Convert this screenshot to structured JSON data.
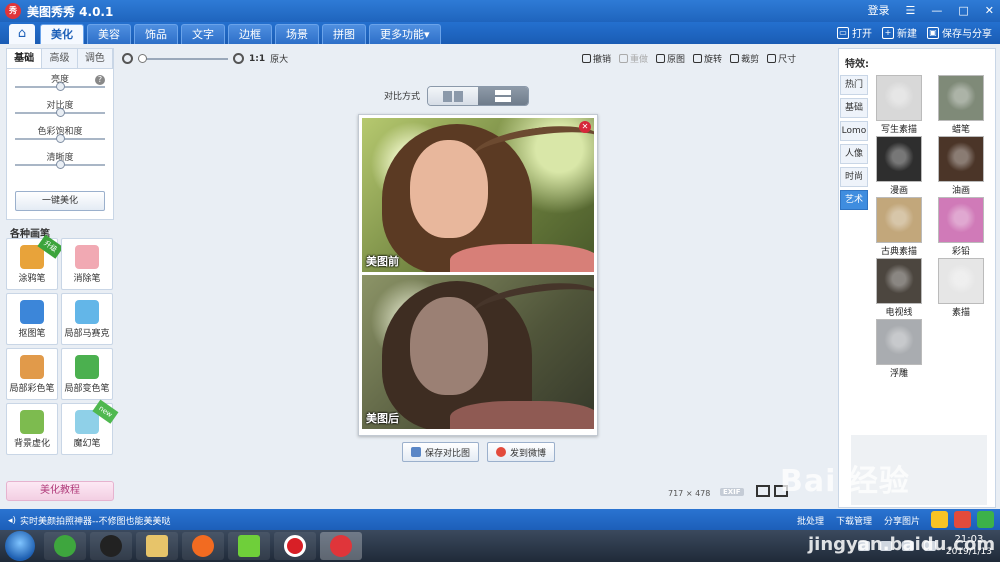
{
  "app": {
    "title": "美图秀秀 4.0.1",
    "logo_text": "秀"
  },
  "titlebar": {
    "login": "登录",
    "menu": "☰",
    "minimize": "—",
    "maximize": "□",
    "close": "✕"
  },
  "tabs": [
    {
      "label": "美化",
      "active": true
    },
    {
      "label": "美容",
      "active": false
    },
    {
      "label": "饰品",
      "active": false
    },
    {
      "label": "文字",
      "active": false
    },
    {
      "label": "边框",
      "active": false
    },
    {
      "label": "场景",
      "active": false
    },
    {
      "label": "拼图",
      "active": false
    },
    {
      "label": "更多功能▾",
      "active": false
    }
  ],
  "file_actions": {
    "open": "打开",
    "new": "新建",
    "save_share": "保存与分享"
  },
  "left_panel": {
    "sub_tabs": [
      "基础",
      "高级",
      "调色"
    ],
    "sliders": [
      {
        "label": "亮度",
        "value": 0.5
      },
      {
        "label": "对比度",
        "value": 0.5
      },
      {
        "label": "色彩饱和度",
        "value": 0.5
      },
      {
        "label": "清晰度",
        "value": 0.5
      }
    ],
    "one_click": "一键美化",
    "brush_title": "各种画笔",
    "brushes": [
      {
        "label": "涂鸦笔",
        "badge": "升级",
        "color": "#e8a33a"
      },
      {
        "label": "消除笔",
        "badge": "",
        "color": "#f1a9b3"
      },
      {
        "label": "抠图笔",
        "badge": "",
        "color": "#3c86d9"
      },
      {
        "label": "局部马赛克",
        "badge": "",
        "color": "#63b6e8"
      },
      {
        "label": "局部彩色笔",
        "badge": "",
        "color": "#e19a4a"
      },
      {
        "label": "局部变色笔",
        "badge": "",
        "color": "#4bb04f"
      },
      {
        "label": "背景虚化",
        "badge": "",
        "color": "#7dbb4f"
      },
      {
        "label": "魔幻笔",
        "badge": "new",
        "color": "#8fd0e8"
      }
    ],
    "tutorial": "美化教程"
  },
  "toolbar": {
    "zoom_ratio": "1:1",
    "zoom_label": "原大",
    "tools": [
      {
        "label": "撤销",
        "enabled": true
      },
      {
        "label": "重做",
        "enabled": false
      },
      {
        "label": "原图",
        "enabled": true
      },
      {
        "label": "旋转",
        "enabled": true
      },
      {
        "label": "裁剪",
        "enabled": true
      },
      {
        "label": "尺寸",
        "enabled": true
      }
    ]
  },
  "compare": {
    "mode_label": "对比方式",
    "before_label": "美图前",
    "after_label": "美图后",
    "save_button": "保存对比图",
    "weibo_button": "发到微博"
  },
  "image_info": {
    "width": "717",
    "x": "×",
    "height": "478",
    "exif": "EXIF"
  },
  "effects": {
    "title": "特效:",
    "categories": [
      {
        "label": "热门",
        "active": false
      },
      {
        "label": "基础",
        "active": false
      },
      {
        "label": "Lomo",
        "active": false
      },
      {
        "label": "人像",
        "active": false
      },
      {
        "label": "时尚",
        "active": false
      },
      {
        "label": "艺术",
        "active": true
      }
    ],
    "items": [
      {
        "label": "写生素描",
        "color": "#d8d8d8"
      },
      {
        "label": "蜡笔",
        "color": "#7f8a78"
      },
      {
        "label": "漫画",
        "color": "#2e2e2e"
      },
      {
        "label": "油画",
        "color": "#4b3528"
      },
      {
        "label": "古典素描",
        "color": "#c2a77b"
      },
      {
        "label": "彩铅",
        "color": "#d07ab8"
      },
      {
        "label": "电视线",
        "color": "#4c463f"
      },
      {
        "label": "素描",
        "color": "#e6e6e6"
      },
      {
        "label": "浮雕",
        "color": "#a9acb0"
      }
    ]
  },
  "status": {
    "message": "实时美颜拍照神器--不修图也能美美哒",
    "batch": "批处理",
    "download": "下载管理",
    "share": "分享图片"
  },
  "taskbar": {
    "time": "21:03",
    "date": "2019/1/13"
  },
  "watermark": {
    "main": "Bai 经验",
    "sub": "jingyan.baidu.com"
  }
}
